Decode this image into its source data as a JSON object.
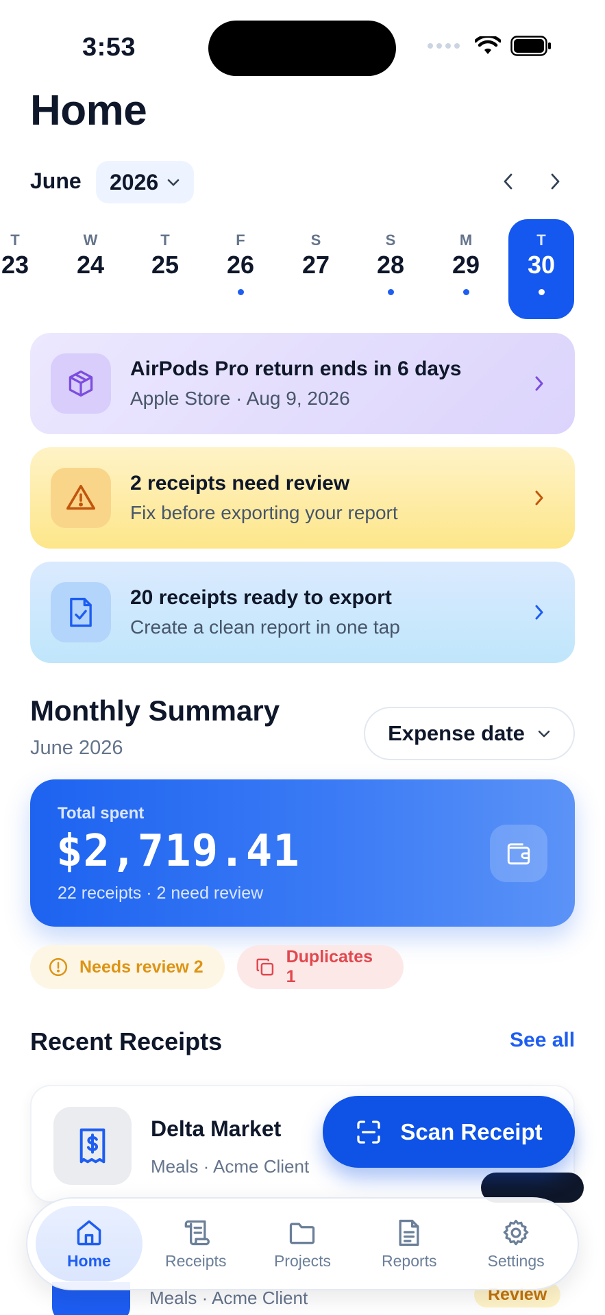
{
  "status_bar": {
    "time": "3:53"
  },
  "header": {
    "title": "Home"
  },
  "calendar": {
    "month": "June",
    "year": "2026",
    "days": [
      {
        "dow": "T",
        "num": "23",
        "dot": false,
        "selected": false
      },
      {
        "dow": "W",
        "num": "24",
        "dot": false,
        "selected": false
      },
      {
        "dow": "T",
        "num": "25",
        "dot": false,
        "selected": false
      },
      {
        "dow": "F",
        "num": "26",
        "dot": true,
        "selected": false
      },
      {
        "dow": "S",
        "num": "27",
        "dot": false,
        "selected": false
      },
      {
        "dow": "S",
        "num": "28",
        "dot": true,
        "selected": false
      },
      {
        "dow": "M",
        "num": "29",
        "dot": true,
        "selected": false
      },
      {
        "dow": "T",
        "num": "30",
        "dot": true,
        "selected": true
      }
    ]
  },
  "alerts": [
    {
      "title": "AirPods Pro return ends in 6 days",
      "subtitle": "Apple Store · Aug 9, 2026",
      "icon": "box-icon",
      "color": "#7c4ddf"
    },
    {
      "title": "2 receipts need review",
      "subtitle": "Fix before exporting your report",
      "icon": "warning-icon",
      "color": "#c2560c"
    },
    {
      "title": "20 receipts ready to export",
      "subtitle": "Create a clean report in one tap",
      "icon": "file-check-icon",
      "color": "#1d5df2"
    }
  ],
  "summary": {
    "title": "Monthly Summary",
    "subtitle": "June 2026",
    "sort_label": "Expense date",
    "total_label": "Total spent",
    "total_amount": "$2,719.41",
    "total_meta": "22 receipts · 2 need review",
    "chips": {
      "review": "Needs review 2",
      "duplicates": "Duplicates 1"
    }
  },
  "recent": {
    "title": "Recent Receipts",
    "see_all": "See all",
    "items": [
      {
        "merchant": "Delta Market",
        "meta": "Meals · Acme Client",
        "icon": "receipt-dollar-icon"
      },
      {
        "merchant": "",
        "meta": "Meals · Acme Client",
        "badge": "Review"
      }
    ]
  },
  "fab": {
    "label": "Scan Receipt",
    "icon": "scan-icon"
  },
  "tabs": [
    {
      "label": "Home",
      "icon": "home-icon",
      "active": true
    },
    {
      "label": "Receipts",
      "icon": "scroll-icon",
      "active": false
    },
    {
      "label": "Projects",
      "icon": "folder-icon",
      "active": false
    },
    {
      "label": "Reports",
      "icon": "document-icon",
      "active": false
    },
    {
      "label": "Settings",
      "icon": "gear-icon",
      "active": false
    }
  ],
  "colors": {
    "accent": "#1d5df2",
    "text": "#0f172a",
    "muted": "#64748b"
  }
}
